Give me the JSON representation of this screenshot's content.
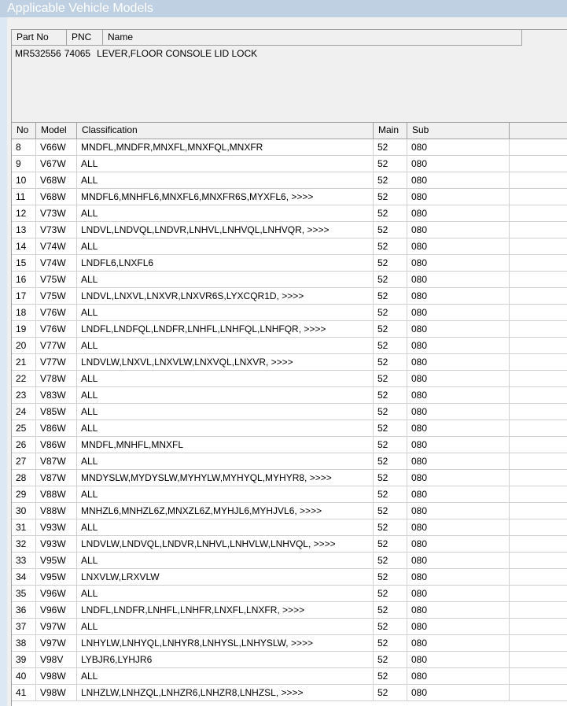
{
  "window": {
    "title": "Applicable Vehicle Models"
  },
  "part_table": {
    "headers": [
      "Part No",
      "PNC",
      "Name"
    ],
    "row": {
      "part_no": "MR532556",
      "pnc": "74065",
      "name": "LEVER,FLOOR CONSOLE LID LOCK"
    }
  },
  "model_table": {
    "headers": [
      "No",
      "Model",
      "Classification",
      "Main",
      "Sub"
    ],
    "rows": [
      [
        "8",
        "V66W",
        "MNDFL,MNDFR,MNXFL,MNXFQL,MNXFR",
        "52",
        "080"
      ],
      [
        "9",
        "V67W",
        "ALL",
        "52",
        "080"
      ],
      [
        "10",
        "V68W",
        "ALL",
        "52",
        "080"
      ],
      [
        "11",
        "V68W",
        "MNDFL6,MNHFL6,MNXFL6,MNXFR6S,MYXFL6,  >>>>",
        "52",
        "080"
      ],
      [
        "12",
        "V73W",
        "ALL",
        "52",
        "080"
      ],
      [
        "13",
        "V73W",
        "LNDVL,LNDVQL,LNDVR,LNHVL,LNHVQL,LNHVQR,  >>>>",
        "52",
        "080"
      ],
      [
        "14",
        "V74W",
        "ALL",
        "52",
        "080"
      ],
      [
        "15",
        "V74W",
        "LNDFL6,LNXFL6",
        "52",
        "080"
      ],
      [
        "16",
        "V75W",
        "ALL",
        "52",
        "080"
      ],
      [
        "17",
        "V75W",
        "LNDVL,LNXVL,LNXVR,LNXVR6S,LYXCQR1D,  >>>>",
        "52",
        "080"
      ],
      [
        "18",
        "V76W",
        "ALL",
        "52",
        "080"
      ],
      [
        "19",
        "V76W",
        "LNDFL,LNDFQL,LNDFR,LNHFL,LNHFQL,LNHFQR,  >>>>",
        "52",
        "080"
      ],
      [
        "20",
        "V77W",
        "ALL",
        "52",
        "080"
      ],
      [
        "21",
        "V77W",
        "LNDVLW,LNXVL,LNXVLW,LNXVQL,LNXVR,  >>>>",
        "52",
        "080"
      ],
      [
        "22",
        "V78W",
        "ALL",
        "52",
        "080"
      ],
      [
        "23",
        "V83W",
        "ALL",
        "52",
        "080"
      ],
      [
        "24",
        "V85W",
        "ALL",
        "52",
        "080"
      ],
      [
        "25",
        "V86W",
        "ALL",
        "52",
        "080"
      ],
      [
        "26",
        "V86W",
        "MNDFL,MNHFL,MNXFL",
        "52",
        "080"
      ],
      [
        "27",
        "V87W",
        "ALL",
        "52",
        "080"
      ],
      [
        "28",
        "V87W",
        "MNDYSLW,MYDYSLW,MYHYLW,MYHYQL,MYHYR8,  >>>>",
        "52",
        "080"
      ],
      [
        "29",
        "V88W",
        "ALL",
        "52",
        "080"
      ],
      [
        "30",
        "V88W",
        "MNHZL6,MNHZL6Z,MNXZL6Z,MYHJL6,MYHJVL6,  >>>>",
        "52",
        "080"
      ],
      [
        "31",
        "V93W",
        "ALL",
        "52",
        "080"
      ],
      [
        "32",
        "V93W",
        "LNDVLW,LNDVQL,LNDVR,LNHVL,LNHVLW,LNHVQL,  >>>>",
        "52",
        "080"
      ],
      [
        "33",
        "V95W",
        "ALL",
        "52",
        "080"
      ],
      [
        "34",
        "V95W",
        "LNXVLW,LRXVLW",
        "52",
        "080"
      ],
      [
        "35",
        "V96W",
        "ALL",
        "52",
        "080"
      ],
      [
        "36",
        "V96W",
        "LNDFL,LNDFR,LNHFL,LNHFR,LNXFL,LNXFR,  >>>>",
        "52",
        "080"
      ],
      [
        "37",
        "V97W",
        "ALL",
        "52",
        "080"
      ],
      [
        "38",
        "V97W",
        "LNHYLW,LNHYQL,LNHYR8,LNHYSL,LNHYSLW,  >>>>",
        "52",
        "080"
      ],
      [
        "39",
        "V98V",
        "LYBJR6,LYHJR6",
        "52",
        "080"
      ],
      [
        "40",
        "V98W",
        "ALL",
        "52",
        "080"
      ],
      [
        "41",
        "V98W",
        "LNHZLW,LNHZQL,LNHZR6,LNHZR8,LNHZSL,  >>>>",
        "52",
        "080"
      ]
    ]
  }
}
